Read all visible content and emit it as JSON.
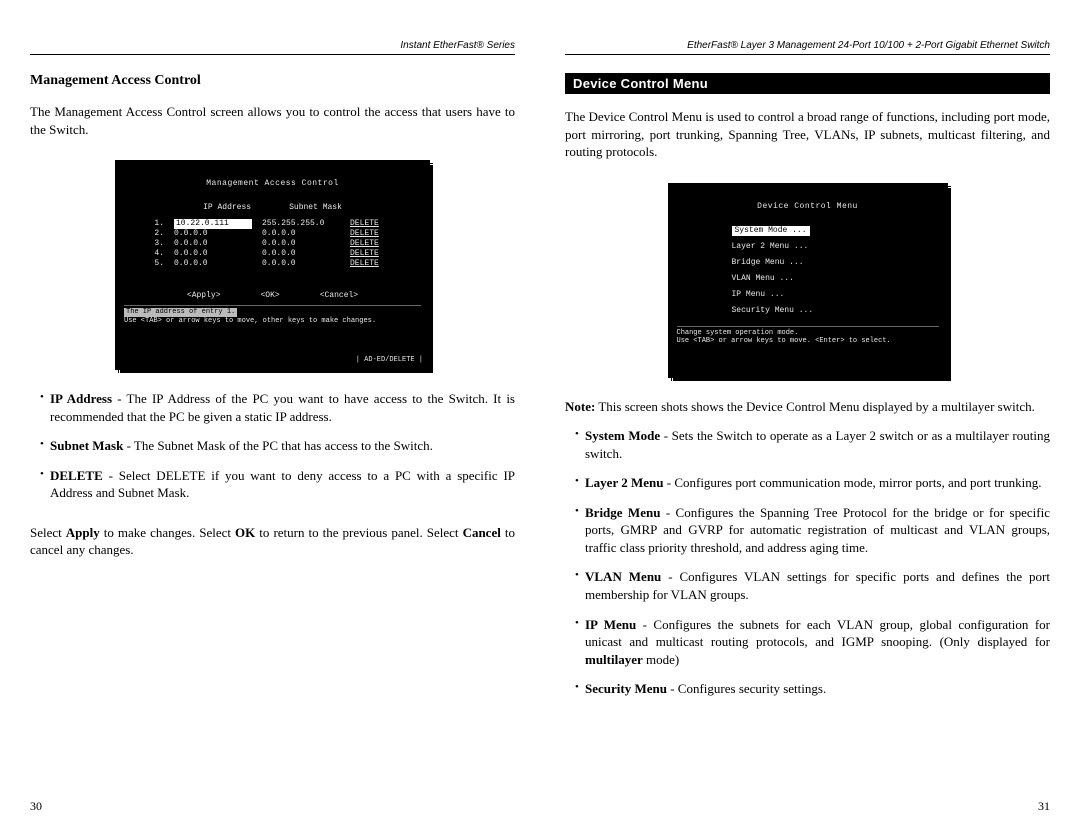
{
  "left": {
    "header": "Instant EtherFast® Series",
    "subtitle": "Management Access Control",
    "intro": "The Management Access Control screen allows you to control the access that users have to the Switch.",
    "terminal": {
      "title": "Management Access Control",
      "col1": "IP Address",
      "col2": "Subnet Mask",
      "rows": [
        {
          "n": "1.",
          "ip": "10.22.0.111",
          "sm": "255.255.255.0",
          "del": "DELETE",
          "hl": true
        },
        {
          "n": "2.",
          "ip": "0.0.0.0",
          "sm": "0.0.0.0",
          "del": "DELETE",
          "hl": false
        },
        {
          "n": "3.",
          "ip": "0.0.0.0",
          "sm": "0.0.0.0",
          "del": "DELETE",
          "hl": false
        },
        {
          "n": "4.",
          "ip": "0.0.0.0",
          "sm": "0.0.0.0",
          "del": "DELETE",
          "hl": false
        },
        {
          "n": "5.",
          "ip": "0.0.0.0",
          "sm": "0.0.0.0",
          "del": "DELETE",
          "hl": false
        }
      ],
      "apply": "<Apply>",
      "ok": "<OK>",
      "cancel": "<Cancel>",
      "hint1": "The IP address of entry 1.",
      "hint2": "Use <TAB> or arrow keys to move, other keys to make changes.",
      "corner": "| AD-ED/DELETE |"
    },
    "bullets": [
      {
        "b": "IP Address",
        "t": " - The IP Address of the PC you want to have access to the Switch. It is recommended that the PC be given a static IP address."
      },
      {
        "b": "Subnet Mask",
        "t": " - The Subnet Mask of the PC that has access to the Switch."
      },
      {
        "b": "DELETE",
        "t": " - Select DELETE if you want to deny access to a PC with a specific IP Address and Subnet Mask."
      }
    ],
    "para2_a": "Select ",
    "para2_b": "Apply",
    "para2_c": " to make changes. Select ",
    "para2_d": "OK",
    "para2_e": " to return to the previous panel. Select ",
    "para2_f": "Cancel",
    "para2_g": " to cancel any changes.",
    "pagenum": "30"
  },
  "right": {
    "header": "EtherFast® Layer 3 Management 24-Port 10/100 + 2-Port Gigabit Ethernet Switch",
    "band": "Device Control Menu",
    "intro": "The Device Control Menu is used to control a broad range of functions, including port mode, port mirroring, port trunking, Spanning Tree, VLANs, IP subnets, multicast filtering, and routing protocols.",
    "terminal": {
      "title": "Device Control Menu",
      "items": [
        {
          "label": "System Mode ...",
          "sel": true
        },
        {
          "label": "Layer 2 Menu ...",
          "sel": false
        },
        {
          "label": "Bridge Menu ...",
          "sel": false
        },
        {
          "label": "VLAN Menu ...",
          "sel": false
        },
        {
          "label": "IP Menu ...",
          "sel": false
        },
        {
          "label": "Security Menu ...",
          "sel": false
        }
      ],
      "hint1": "Change system operation mode.",
      "hint2": "Use <TAB> or arrow keys to move. <Enter> to select."
    },
    "note_b": "Note:",
    "note_t": " This screen shots shows the Device Control Menu displayed by a multilayer switch.",
    "bullets": [
      {
        "b": "System Mode",
        "t": " - Sets the Switch to operate as a Layer 2 switch or as a multilayer routing switch."
      },
      {
        "b": "Layer 2 Menu",
        "t": " - Configures port communication mode, mirror ports, and port trunking."
      },
      {
        "b": "Bridge Menu",
        "t": " - Configures the Spanning Tree Protocol for the bridge or for specific ports, GMRP and GVRP for automatic registration of multicast and VLAN groups, traffic class priority threshold, and address aging time."
      },
      {
        "b": "VLAN Menu",
        "t": " - Configures VLAN settings for specific ports and defines the port membership for VLAN groups."
      },
      {
        "b": "IP Menu",
        "t": " - Configures the subnets for each VLAN group, global configuration for unicast and multicast routing protocols, and IGMP snooping. (Only displayed for "
      },
      {
        "b": "Security Menu",
        "t": " - Configures security settings."
      }
    ],
    "multilayer": "multilayer",
    "mode_tail": " mode)",
    "pagenum": "31"
  }
}
